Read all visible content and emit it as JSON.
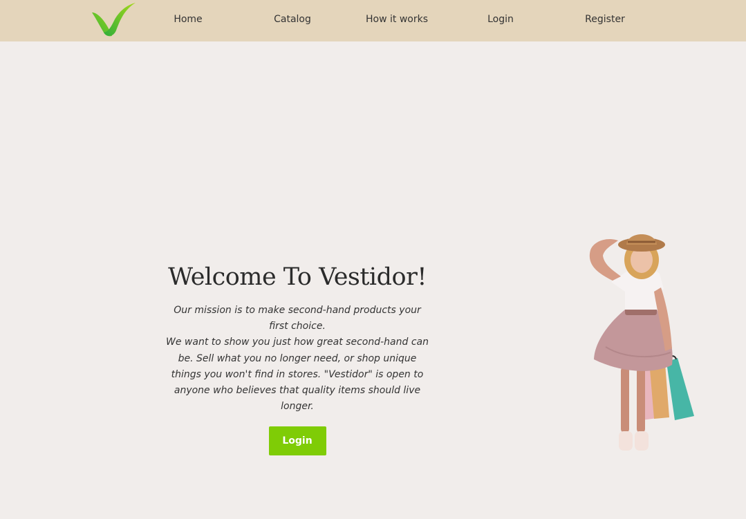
{
  "nav": {
    "home": "Home",
    "catalog": "Catalog",
    "how_it_works": "How it works",
    "login": "Login",
    "register": "Register"
  },
  "hero": {
    "title": "Welcome To Vestidor!",
    "paragraph1": "Our mission is to make second-hand products your first choice.",
    "paragraph2": "We want to show you just how great second-hand can be. Sell what you no longer need, or shop unique things you won't find in stores. \"Vestidor\" is open to anyone who believes that quality items should live longer.",
    "button": "Login"
  },
  "icons": {
    "logo": "checkmark-logo-icon",
    "illustration": "girl-with-shopping-bags"
  },
  "colors": {
    "navbar": "#e4d5bb",
    "background": "#f1edeb",
    "accent": "#7fcc06"
  }
}
